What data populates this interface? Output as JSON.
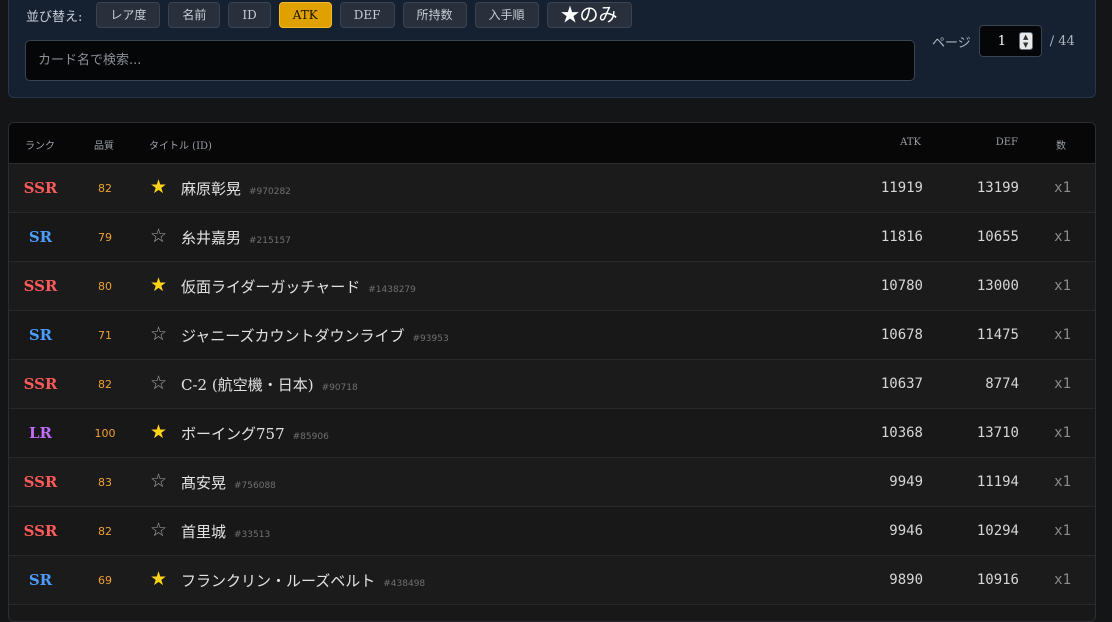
{
  "filters": {
    "sort_label": "並び替え:",
    "sort_buttons": [
      {
        "label": "レア度",
        "active": false
      },
      {
        "label": "名前",
        "active": false
      },
      {
        "label": "ID",
        "active": false
      },
      {
        "label": "ATK",
        "active": true
      },
      {
        "label": "DEF",
        "active": false
      },
      {
        "label": "所持数",
        "active": false
      },
      {
        "label": "入手順",
        "active": false
      },
      {
        "label": "★のみ",
        "active": false
      }
    ],
    "search_placeholder": "カード名で検索...",
    "page_label": "ページ",
    "page_value": "1",
    "page_total": "/ 44"
  },
  "table": {
    "headers": {
      "rank": "ランク",
      "quality": "品質",
      "title": "タイトル (ID)",
      "atk": "ATK",
      "def": "DEF",
      "count": "数"
    },
    "rows": [
      {
        "rank": "SSR",
        "quality": "82",
        "fav": true,
        "title": "麻原彰晃",
        "id": "#970282",
        "atk": "11919",
        "def": "13199",
        "count": "x1"
      },
      {
        "rank": "SR",
        "quality": "79",
        "fav": false,
        "title": "糸井嘉男",
        "id": "#215157",
        "atk": "11816",
        "def": "10655",
        "count": "x1"
      },
      {
        "rank": "SSR",
        "quality": "80",
        "fav": true,
        "title": "仮面ライダーガッチャード",
        "id": "#1438279",
        "atk": "10780",
        "def": "13000",
        "count": "x1"
      },
      {
        "rank": "SR",
        "quality": "71",
        "fav": false,
        "title": "ジャニーズカウントダウンライブ",
        "id": "#93953",
        "atk": "10678",
        "def": "11475",
        "count": "x1"
      },
      {
        "rank": "SSR",
        "quality": "82",
        "fav": false,
        "title": "C-2 (航空機・日本)",
        "id": "#90718",
        "atk": "10637",
        "def": "8774",
        "count": "x1"
      },
      {
        "rank": "LR",
        "quality": "100",
        "fav": true,
        "title": "ボーイング757",
        "id": "#85906",
        "atk": "10368",
        "def": "13710",
        "count": "x1"
      },
      {
        "rank": "SSR",
        "quality": "83",
        "fav": false,
        "title": "髙安晃",
        "id": "#756088",
        "atk": "9949",
        "def": "11194",
        "count": "x1"
      },
      {
        "rank": "SSR",
        "quality": "82",
        "fav": false,
        "title": "首里城",
        "id": "#33513",
        "atk": "9946",
        "def": "10294",
        "count": "x1"
      },
      {
        "rank": "SR",
        "quality": "69",
        "fav": true,
        "title": "フランクリン・ルーズベルト",
        "id": "#438498",
        "atk": "9890",
        "def": "10916",
        "count": "x1"
      }
    ]
  },
  "colors": {
    "accent": "#e0a100",
    "ssr": "#ff5a5a",
    "sr": "#4a9dff",
    "lr": "#c06cff",
    "quality": "#f0a030",
    "star_on": "#ffd21a"
  },
  "icons": {
    "fav_on": "star-filled-icon",
    "fav_off": "star-outline-icon"
  }
}
